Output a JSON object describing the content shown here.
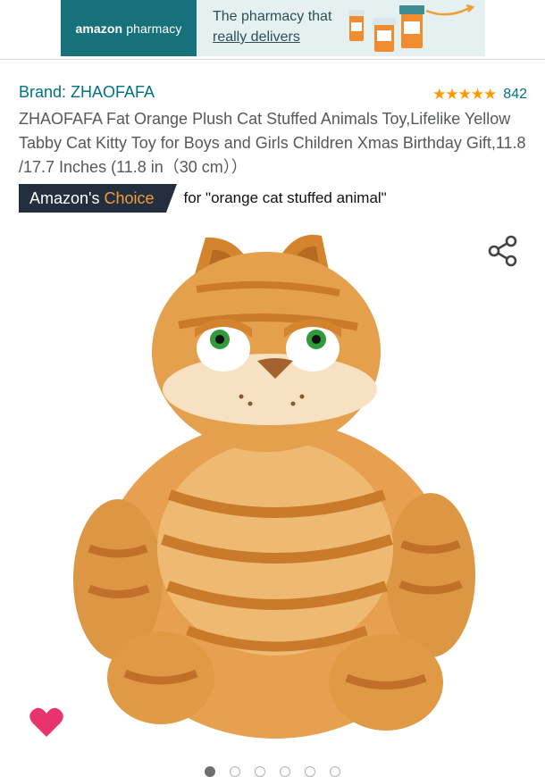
{
  "banner": {
    "logo_prefix": "amazon",
    "logo_suffix": "pharmacy",
    "line1": "The pharmacy that",
    "line2": "really delivers"
  },
  "product": {
    "brand": "Brand: ZHAOFAFA",
    "rating_stars": "★★★★★",
    "rating_value": 5,
    "review_count": "842",
    "title": "ZHAOFAFA Fat Orange Plush Cat Stuffed Animals Toy,Lifelike Yellow Tabby Cat Kitty Toy for Boys and Girls Children Xmas Birthday Gift,11.8 /17.7 Inches (11.8 in（30 cm））"
  },
  "choice": {
    "badge_prefix": "Amazon's",
    "badge_accent": "Choice",
    "for_text": "for \"orange cat stuffed animal\""
  },
  "gallery": {
    "image_count": 6,
    "active_index": 0
  },
  "colors": {
    "link": "#007185",
    "star": "#ff9900",
    "badge_bg": "#232f3e",
    "badge_accent": "#f19e39",
    "heart": "#e8336d",
    "banner_teal": "#17717a"
  },
  "icons": {
    "share": "share-icon",
    "favorite": "heart-icon"
  }
}
